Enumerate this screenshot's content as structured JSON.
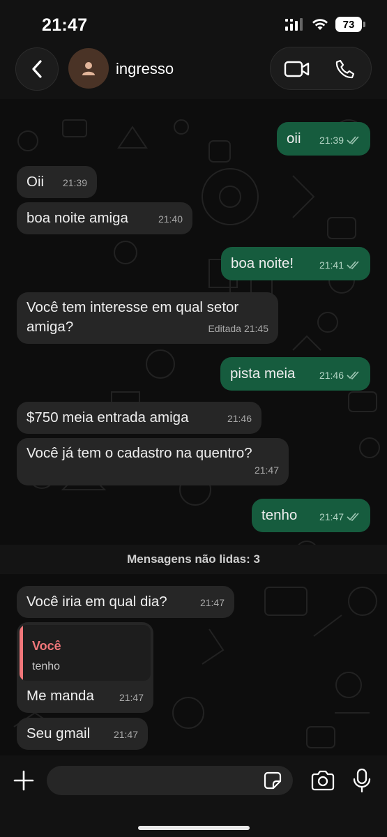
{
  "status_bar": {
    "time": "21:47",
    "battery": "73"
  },
  "header": {
    "contact_name": "ingresso"
  },
  "messages": [
    {
      "dir": "out",
      "text": "oii",
      "time": "21:39"
    },
    {
      "dir": "in",
      "text": "Oii",
      "time": "21:39"
    },
    {
      "dir": "in",
      "text": "boa noite amiga",
      "time": "21:40"
    },
    {
      "dir": "out",
      "text": "boa noite!",
      "time": "21:41"
    },
    {
      "dir": "in",
      "text": "Você tem interesse em qual setor amiga?",
      "edited_label": "Editada",
      "time": "21:45"
    },
    {
      "dir": "out",
      "text": "pista meia",
      "time": "21:46"
    },
    {
      "dir": "in",
      "text": "$750 meia entrada amiga",
      "time": "21:46"
    },
    {
      "dir": "in",
      "text": "Você já tem o cadastro na quentro?",
      "time": "21:47"
    },
    {
      "dir": "out",
      "text": "tenho",
      "time": "21:47"
    },
    {
      "dir": "in",
      "text": "Você iria em qual dia?",
      "time": "21:47"
    },
    {
      "dir": "in",
      "text": "Me manda",
      "time": "21:47",
      "reply": {
        "author": "Você",
        "text": "tenho"
      }
    },
    {
      "dir": "in",
      "text": "Seu gmail",
      "time": "21:47"
    }
  ],
  "unread_divider": "Mensagens não lidas: 3",
  "composer": {
    "placeholder": ""
  },
  "colors": {
    "outgoing_bubble": "#165c3e",
    "incoming_bubble": "#262626",
    "reply_accent": "#f2777a",
    "background": "#0d0d0d"
  },
  "icons": [
    "back-chevron-icon",
    "person-icon",
    "video-icon",
    "phone-icon",
    "plus-icon",
    "sticker-icon",
    "camera-icon",
    "mic-icon",
    "double-check-icon",
    "signal-icon",
    "wifi-icon",
    "battery-icon"
  ]
}
